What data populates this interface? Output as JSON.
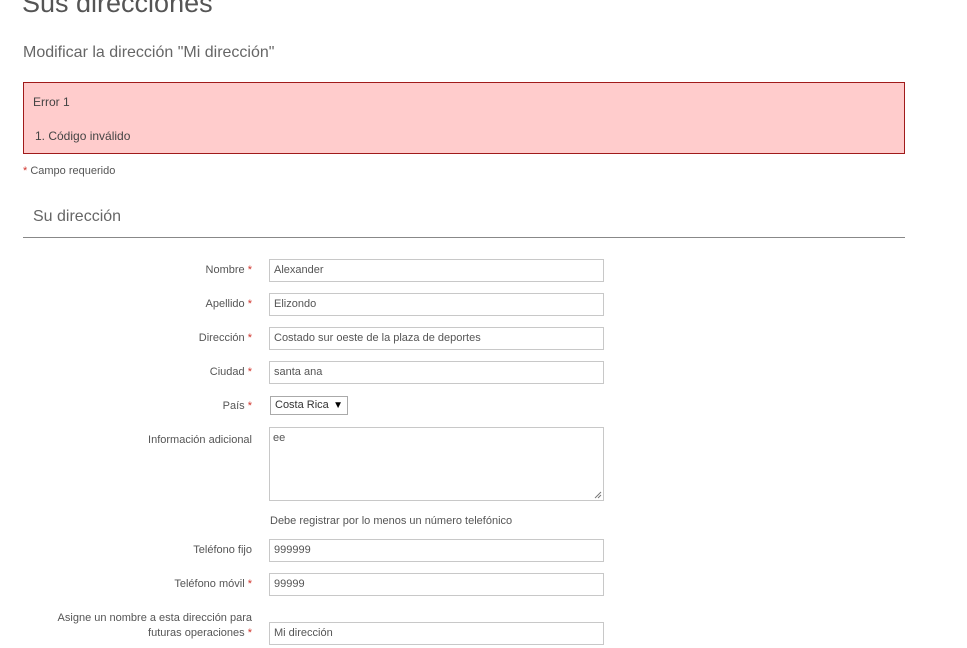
{
  "page_title": "Sus direcciones",
  "subtitle": "Modificar la dirección \"Mi dirección\"",
  "error": {
    "title": "Error 1",
    "items": [
      "1.  Código inválido"
    ]
  },
  "required_note": {
    "star": "*",
    "text": " Campo requerido"
  },
  "section_title": "Su dirección",
  "form": {
    "required_star": "*",
    "firstname": {
      "label": "Nombre",
      "value": "Alexander"
    },
    "lastname": {
      "label": "Apellido",
      "value": "Elizondo"
    },
    "address": {
      "label": "Dirección",
      "value": "Costado sur oeste de la plaza de deportes"
    },
    "city": {
      "label": "Ciudad",
      "value": "santa ana"
    },
    "country": {
      "label": "País",
      "selected": "Costa Rica",
      "arrow": "▼"
    },
    "other": {
      "label": "Información adicional",
      "value": "ee"
    },
    "phone_note": "Debe registrar por lo menos un número telefónico",
    "phone": {
      "label": "Teléfono fijo",
      "value": "999999"
    },
    "phone_mobile": {
      "label": "Teléfono móvil",
      "value": "99999"
    },
    "alias": {
      "label_line1": "Asigne un nombre a esta dirección para",
      "label_line2": "futuras operaciones",
      "value": "Mi dirección"
    }
  },
  "colors": {
    "error_bg": "#ffcccc",
    "error_border": "#a01a1a",
    "required_star": "#d0342c"
  }
}
